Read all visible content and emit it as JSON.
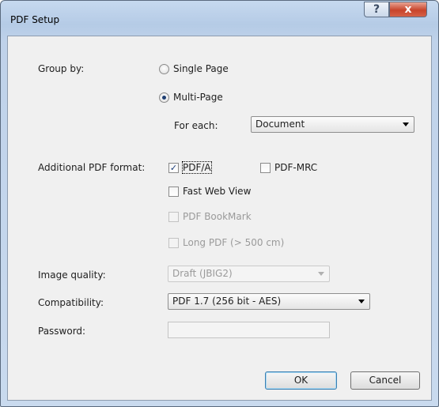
{
  "window": {
    "title": "PDF Setup"
  },
  "titlebar": {
    "help": "?",
    "close": "x"
  },
  "group_by": {
    "label": "Group by:",
    "options": [
      {
        "label": "Single Page",
        "selected": false
      },
      {
        "label": "Multi-Page",
        "selected": true
      }
    ],
    "for_each_label": "For each:",
    "for_each_value": "Document"
  },
  "additional_pdf_format": {
    "label": "Additional PDF format:",
    "options": [
      {
        "label": "PDF/A",
        "checked": true,
        "enabled": true
      },
      {
        "label": "PDF-MRC",
        "checked": false,
        "enabled": true
      },
      {
        "label": "Fast Web View",
        "checked": false,
        "enabled": true
      },
      {
        "label": "PDF BookMark",
        "checked": false,
        "enabled": false
      },
      {
        "label": "Long PDF (> 500 cm)",
        "checked": false,
        "enabled": false
      }
    ]
  },
  "image_quality": {
    "label": "Image quality:",
    "value": "Draft (JBIG2)",
    "enabled": false
  },
  "compatibility": {
    "label": "Compatibility:",
    "value": "PDF 1.7 (256 bit - AES)"
  },
  "password": {
    "label": "Password:",
    "value": "",
    "enabled": false
  },
  "buttons": {
    "ok": "OK",
    "cancel": "Cancel"
  },
  "check_glyph": "✓"
}
